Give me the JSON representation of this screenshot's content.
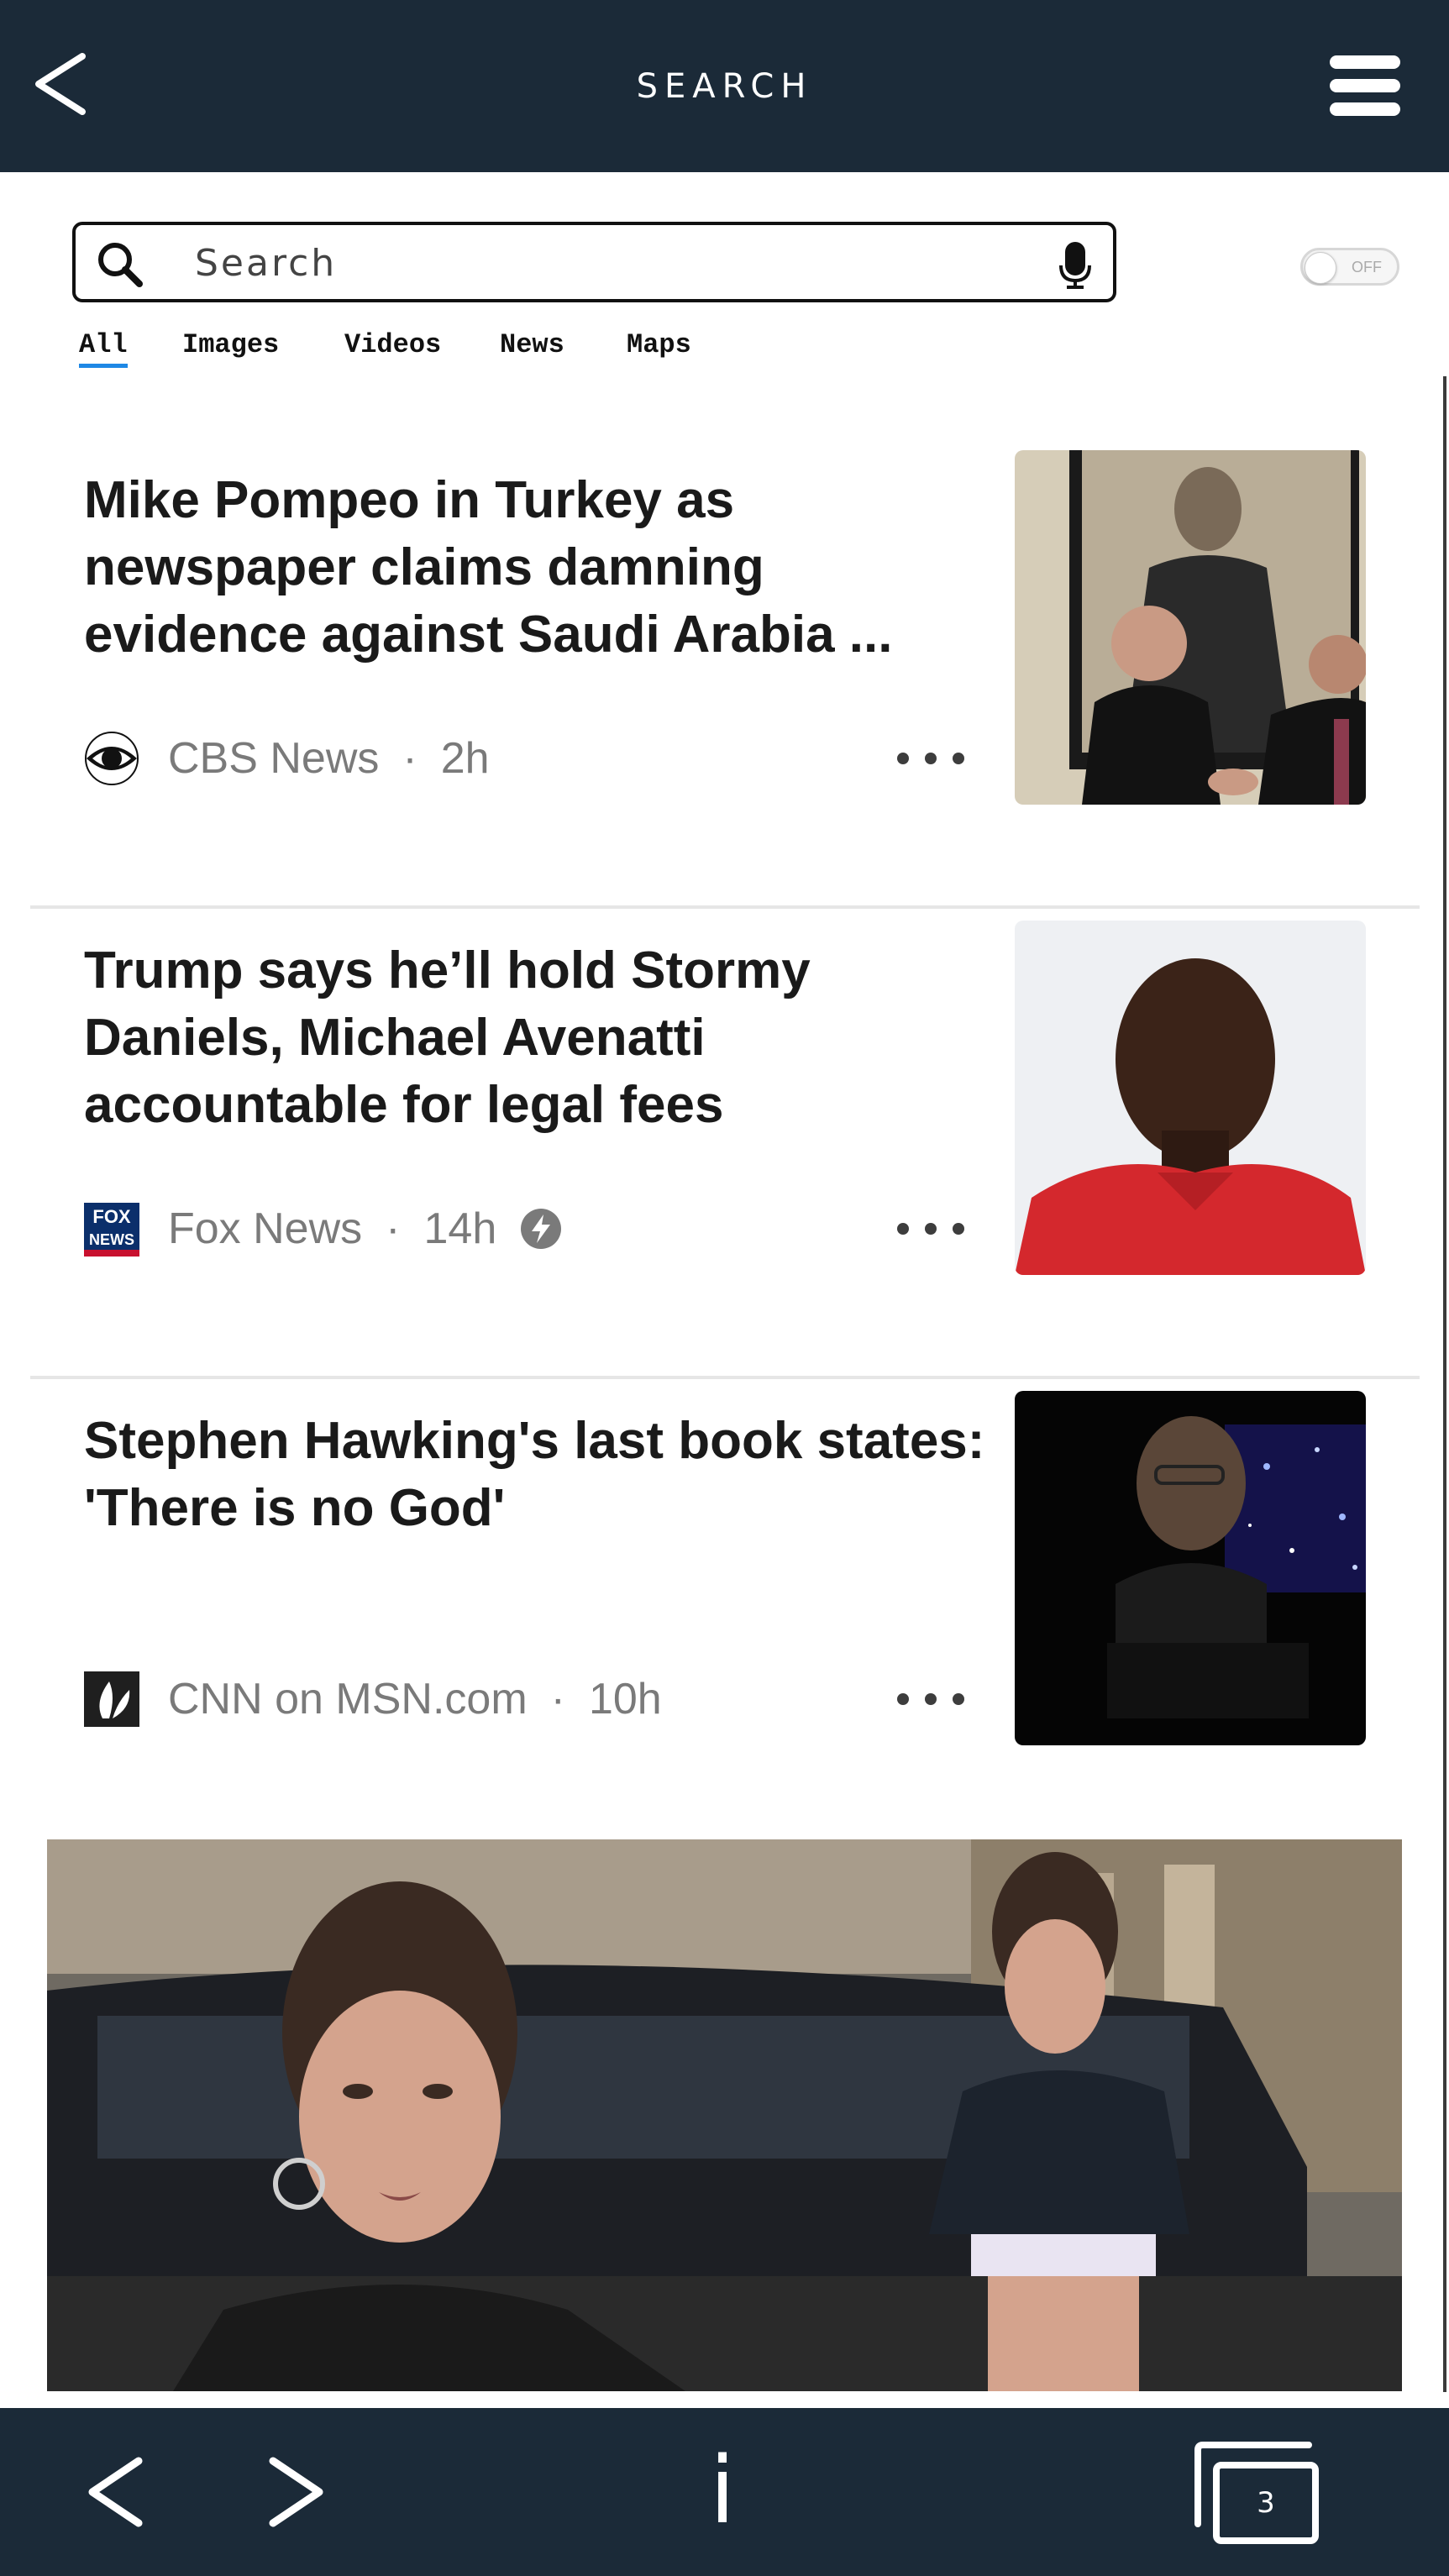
{
  "header": {
    "title": "SEARCH",
    "back_icon": "chevron-left-icon",
    "menu_icon": "hamburger-menu-icon"
  },
  "search": {
    "placeholder": "Search",
    "value": "",
    "toggle_label": "OFF"
  },
  "tabs": [
    {
      "label": "All",
      "active": true
    },
    {
      "label": "Images",
      "active": false
    },
    {
      "label": "Videos",
      "active": false
    },
    {
      "label": "News",
      "active": false
    },
    {
      "label": "Maps",
      "active": false
    }
  ],
  "articles": [
    {
      "headline": "Mike Pompeo in Turkey as newspaper claims damning evidence against Saudi Arabia ...",
      "source": "CBS News",
      "time": "2h",
      "logo_icon": "cbs-eye-icon",
      "thumbnail": "pompeo-photo"
    },
    {
      "headline": "Trump says he’ll hold Stormy Daniels, Michael Avenatti accountable for legal fees",
      "source": "Fox News",
      "time": "14h",
      "logo_icon": "fox-news-logo",
      "badge_icon": "bolt-icon",
      "thumbnail": "man-red-shirt-photo"
    },
    {
      "headline": "Stephen Hawking's last book states: 'There is no God'",
      "source": "CNN on MSN.com",
      "time": "10h",
      "logo_icon": "msn-butterfly-icon",
      "thumbnail": "hawking-photo"
    }
  ],
  "fox_logo_text": [
    "FOX",
    "NEWS"
  ],
  "bottom_nav": {
    "tab_count": "3",
    "info_label": "i"
  },
  "colors": {
    "bar": "#1b2a38",
    "accent": "#1e88e5",
    "text": "#1a1a1a",
    "meta": "#7a7a7a"
  }
}
